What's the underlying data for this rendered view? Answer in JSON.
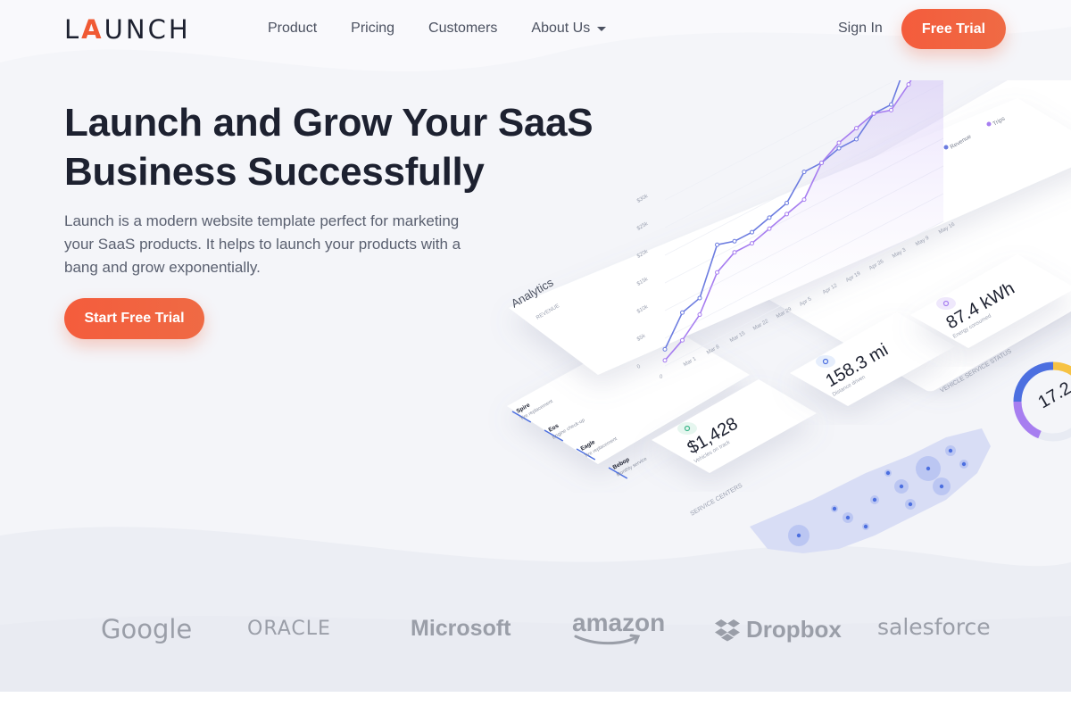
{
  "nav": {
    "logo": "LAUNCH",
    "links": [
      {
        "label": "Product"
      },
      {
        "label": "Pricing"
      },
      {
        "label": "Customers"
      },
      {
        "label": "About Us"
      }
    ],
    "sign_in": "Sign In",
    "cta": "Free Trial"
  },
  "hero": {
    "title_line1": "Launch and Grow Your SaaS",
    "title_line2": "Business Successfully",
    "subtitle": "Launch is a modern website template perfect for marketing your SaaS products. It helps to launch your products with a bang and grow exponentially.",
    "cta": "Start Free Trial"
  },
  "dashboard": {
    "panel_title": "Analytics",
    "chart_label": "REVENUE",
    "legend": [
      "Revenue",
      "Trips"
    ],
    "y_ticks": [
      "$30k",
      "$25k",
      "$20k",
      "$15k",
      "$10k",
      "$5k",
      "0"
    ],
    "x_ticks": [
      "Mar 1",
      "Mar 8",
      "Mar 15",
      "Mar 22",
      "Mar 29",
      "Apr 5",
      "Apr 12",
      "Apr 19",
      "Apr 26",
      "May 3",
      "May 9",
      "May 16"
    ],
    "revenue_series": [
      3,
      8,
      9,
      17,
      16,
      16,
      17,
      18,
      22,
      22,
      23,
      23,
      26,
      26,
      33,
      33,
      34
    ],
    "trips_series": [
      1,
      3,
      6,
      12,
      14,
      14,
      15,
      16,
      17,
      22,
      24,
      25,
      26,
      25,
      28,
      32,
      31
    ],
    "stats": [
      {
        "value": "$1,428",
        "label": "Vehicles on track",
        "icon": "check-icon"
      },
      {
        "value": "158.3 mi",
        "label": "Distance driven",
        "icon": "pin-icon"
      },
      {
        "value": "87.4 kWh",
        "label": "Energy consumed",
        "icon": "bolt-icon"
      }
    ],
    "service_list": [
      {
        "name": "Spire",
        "task": "Tire replacement"
      },
      {
        "name": "Eos",
        "task": "Engine check-up"
      },
      {
        "name": "Eagle",
        "task": "Tire replacement"
      },
      {
        "name": "Bebop",
        "task": "Monthly service"
      }
    ],
    "map_label": "SERVICE CENTERS",
    "status_label": "VEHICLE SERVICE STATUS",
    "status_value": "17.2",
    "colors": {
      "revenue": "#6c7ce0",
      "trips": "#a77ef0",
      "accent": "#f05a34",
      "map_dot": "#4c6fe0"
    }
  },
  "brands": {
    "google": "Google",
    "oracle": "ORACLE",
    "microsoft": "Microsoft",
    "amazon": "amazon",
    "dropbox": "Dropbox",
    "salesforce": "salesforce"
  }
}
